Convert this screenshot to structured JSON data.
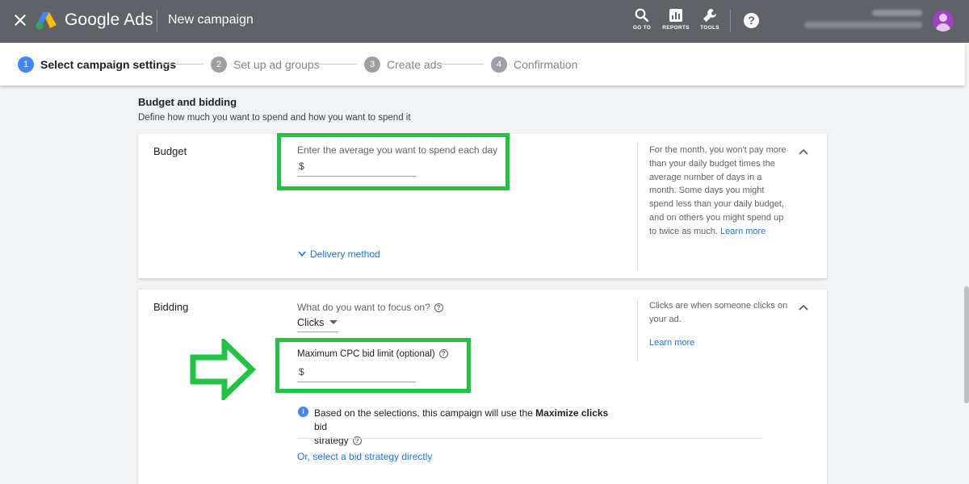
{
  "topbar": {
    "brand": "Google Ads",
    "page_title": "New campaign",
    "goto_label": "GO TO",
    "reports_label": "REPORTS",
    "tools_label": "TOOLS",
    "help_glyph": "?"
  },
  "stepper": {
    "steps": [
      {
        "num": "1",
        "label": "Select campaign settings"
      },
      {
        "num": "2",
        "label": "Set up ad groups"
      },
      {
        "num": "3",
        "label": "Create ads"
      },
      {
        "num": "4",
        "label": "Confirmation"
      }
    ]
  },
  "section": {
    "title": "Budget and bidding",
    "subtitle": "Define how much you want to spend and how you want to spend it"
  },
  "budget": {
    "label": "Budget",
    "field_label": "Enter the average you want to spend each day",
    "currency": "$",
    "help_text": "For the month, you won't pay more than your daily budget times the average number of days in a month. Some days you might spend less than your daily budget, and on others you might spend up to twice as much.",
    "learn_more": "Learn more",
    "delivery_method": "Delivery method"
  },
  "bidding": {
    "label": "Bidding",
    "focus_question": "What do you want to focus on?",
    "focus_value": "Clicks",
    "max_cpc_label": "Maximum CPC bid limit (optional)",
    "currency": "$",
    "info_prefix": "Based on the selections, this campaign will use the ",
    "info_bold": "Maximize clicks",
    "info_suffix": " bid",
    "info_line2": "strategy",
    "select_directly": "Or, select a bid strategy directly",
    "help_text": "Clicks are when someone clicks on your ad.",
    "learn_more": "Learn more"
  },
  "colors": {
    "topbar": "#5f6368",
    "highlight": "#21c442",
    "link": "#1a73e8",
    "active_step": "#4285f4"
  }
}
